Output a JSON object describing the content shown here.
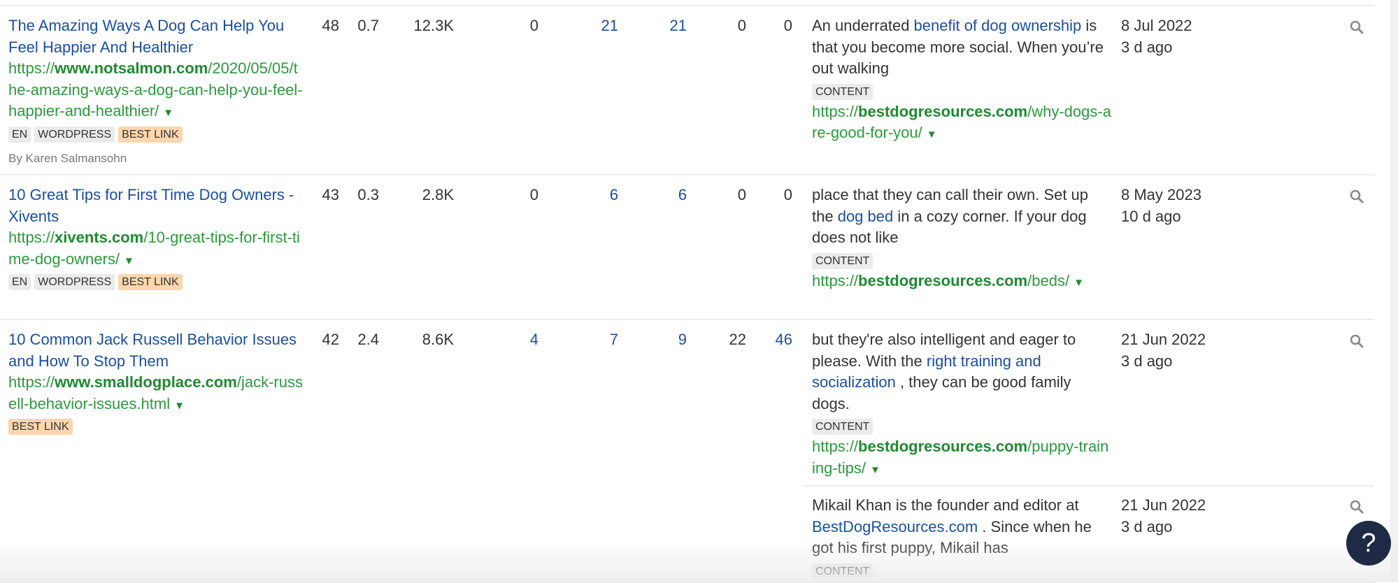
{
  "colors": {
    "link": "#1a4fa0",
    "url": "#2a9a3c",
    "tag": "#ebebeb",
    "best_tag": "#fdd6ad",
    "help": "#1f2b44"
  },
  "rows": [
    {
      "title": "The Amazing Ways A Dog Can Help You Feel Happier And Healthier",
      "url_prefix": "https://",
      "url_domain": "www.notsalmon.com",
      "url_path": "/2020/05/05/the-amazing-ways-a-dog-can-help-you-feel-happier-and-healthier/",
      "tags": [
        "EN",
        "WORDPRESS",
        "BEST LINK"
      ],
      "author": "By Karen Salmansohn",
      "metrics": [
        {
          "v": "48",
          "link": false
        },
        {
          "v": "0.7",
          "link": false
        },
        {
          "v": "12.3K",
          "link": false
        },
        {
          "v": "0",
          "link": false
        },
        {
          "v": "21",
          "link": true
        },
        {
          "v": "21",
          "link": true
        },
        {
          "v": "0",
          "link": false
        },
        {
          "v": "0",
          "link": false
        }
      ],
      "anchors": [
        {
          "before": "An underrated ",
          "link": "benefit of dog ownership",
          "after": " is that you become more social. When you’re out walking",
          "tag": "CONTENT",
          "target_prefix": "https://",
          "target_domain": "bestdogresources.com",
          "target_path": "/why-dogs-are-good-for-you/",
          "date": "8 Jul 2022",
          "ago": "3 d ago"
        }
      ]
    },
    {
      "title": "10 Great Tips for First Time Dog Owners - Xivents",
      "url_prefix": "https://",
      "url_domain": "xivents.com",
      "url_path": "/10-great-tips-for-first-time-dog-owners/",
      "tags": [
        "EN",
        "WORDPRESS",
        "BEST LINK"
      ],
      "metrics": [
        {
          "v": "43",
          "link": false
        },
        {
          "v": "0.3",
          "link": false
        },
        {
          "v": "2.8K",
          "link": false
        },
        {
          "v": "0",
          "link": false
        },
        {
          "v": "6",
          "link": true
        },
        {
          "v": "6",
          "link": true
        },
        {
          "v": "0",
          "link": false
        },
        {
          "v": "0",
          "link": false
        }
      ],
      "anchors": [
        {
          "before": "place that they can call their own. Set up the ",
          "link": "dog bed",
          "after": " in a cozy corner. If your dog does not like",
          "tag": "CONTENT",
          "target_prefix": "https://",
          "target_domain": "bestdogresources.com",
          "target_path": "/beds/",
          "date": "8 May 2023",
          "ago": "10 d ago"
        }
      ]
    },
    {
      "title": "10 Common Jack Russell Behavior Issues and How To Stop Them",
      "url_prefix": "https://",
      "url_domain": "www.smalldogplace.com",
      "url_path": "/jack-russell-behavior-issues.html",
      "tags": [
        "BEST LINK"
      ],
      "metrics": [
        {
          "v": "42",
          "link": false
        },
        {
          "v": "2.4",
          "link": false
        },
        {
          "v": "8.6K",
          "link": false
        },
        {
          "v": "4",
          "link": true
        },
        {
          "v": "7",
          "link": true
        },
        {
          "v": "9",
          "link": true
        },
        {
          "v": "22",
          "link": false
        },
        {
          "v": "46",
          "link": true
        }
      ],
      "anchors": [
        {
          "before": "but they're also intelligent and eager to please. With the ",
          "link": "right training and socialization",
          "after": " , they can be good family dogs.",
          "tag": "CONTENT",
          "target_prefix": "https://",
          "target_domain": "bestdogresources.com",
          "target_path": "/puppy-training-tips/",
          "date": "21 Jun 2022",
          "ago": "3 d ago"
        },
        {
          "before": "Mikail Khan is the founder and editor at ",
          "link": "BestDogResources.com",
          "after": " . Since when he got his first puppy, Mikail has",
          "tag": "CONTENT",
          "date": "21 Jun 2022",
          "ago": "3 d ago"
        }
      ]
    }
  ],
  "help": {
    "label": "?"
  },
  "icons": {
    "search": "search-icon",
    "caret": "caret-down-icon",
    "help": "help-icon"
  }
}
